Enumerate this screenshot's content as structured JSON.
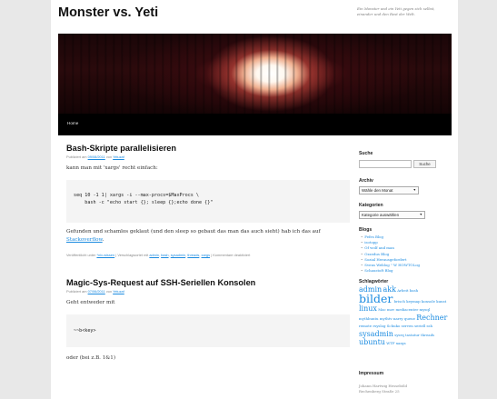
{
  "site": {
    "title": "Monster vs. Yeti",
    "description": "Ein Monster und ein Yeti gegen sich selbst, einander und den Rest der Welt."
  },
  "nav": {
    "home": "Home"
  },
  "posts": [
    {
      "title": "Bash-Skripte parallelisieren",
      "meta_prefix": "Publiziert am ",
      "date": "09/08/2011",
      "meta_by": " von ",
      "author": "Yeluzaf",
      "intro": "kann man mit 'xargs' recht einfach:",
      "code": "seq 10 -1 1| xargs -i --max-procs=$MaxProcs \\\n    bash -c \"echo start {}; sleep {};echo done {}\"",
      "outro": "Gefunden und schamlos geklaut (und den sleep so gebaut das man das auch sieht) hab ich das auf ",
      "outro_link": "Stackoverflow",
      "outro_end": ".",
      "footer": {
        "prefix": "Veröffentlicht unter ",
        "category": "*nix-wissen",
        "tags_prefix": " | Verschlagwortet mit ",
        "tags": [
          "admin",
          "bash",
          "sysadmin",
          "threads",
          "xargs"
        ],
        "comments": "Kommentare deaktiviert"
      }
    },
    {
      "title": "Magic-Sys-Request auf SSH-Seriellen Konsolen",
      "meta_prefix": "Publiziert am ",
      "date": "07/06/2011",
      "meta_by": " von ",
      "author": "Yeluzaf",
      "intro": "Geht entweder mit",
      "code": "~~b<key>",
      "outro": "oder (bei z.B. 1&1)"
    }
  ],
  "sidebar": {
    "search": {
      "title": "Suche",
      "button": "Suche",
      "value": ""
    },
    "archive": {
      "title": "Archiv",
      "selected": "Wähle den Monat"
    },
    "categories": {
      "title": "Kategorien",
      "selected": "Kategorie auswählen"
    },
    "blogs": {
      "title": "Blogs",
      "items": [
        "Fefes Blog",
        "isotopp",
        "Of wolf and man",
        "Ozzedus Blog",
        "Sozial Herausgefordert",
        "Svens Weblog \" W HOWTOLog",
        "Schaustoft Blog"
      ]
    },
    "tags": {
      "title": "Schlagwörter",
      "items": [
        {
          "label": "admin",
          "size": "large"
        },
        {
          "label": "akk",
          "size": "large"
        },
        {
          "label": "Arbeit",
          "size": "small"
        },
        {
          "label": "bash",
          "size": "small"
        },
        {
          "label": "bilder",
          "size": "huge"
        },
        {
          "label": "brisch",
          "size": "small"
        },
        {
          "label": "keymap",
          "size": "small"
        },
        {
          "label": "konsole",
          "size": "small"
        },
        {
          "label": "kunst",
          "size": "small"
        },
        {
          "label": "linux",
          "size": "large"
        },
        {
          "label": "Mac",
          "size": "small"
        },
        {
          "label": "mov",
          "size": "small"
        },
        {
          "label": "mediacenter",
          "size": "small"
        },
        {
          "label": "mysql",
          "size": "small"
        },
        {
          "label": "mythbuntu",
          "size": "small"
        },
        {
          "label": "mythtv",
          "size": "small"
        },
        {
          "label": "narry",
          "size": "small"
        },
        {
          "label": "queue",
          "size": "small"
        },
        {
          "label": "Rechner",
          "size": "large"
        },
        {
          "label": "remote",
          "size": "small"
        },
        {
          "label": "rsyslog",
          "size": "small"
        },
        {
          "label": "Schuko",
          "size": "small"
        },
        {
          "label": "serven",
          "size": "small"
        },
        {
          "label": "seriell",
          "size": "small"
        },
        {
          "label": "ssh",
          "size": "small"
        },
        {
          "label": "sysadmin",
          "size": "large"
        },
        {
          "label": "sysrq",
          "size": "small"
        },
        {
          "label": "tastatur",
          "size": "small"
        },
        {
          "label": "threads",
          "size": "small"
        },
        {
          "label": "ubuntu",
          "size": "large"
        },
        {
          "label": "WTF",
          "size": "small"
        },
        {
          "label": "xargs",
          "size": "small"
        }
      ]
    },
    "impressum": {
      "title": "Impressum",
      "lines": [
        "Johann Hartwig Hesseböld",
        "Rechenberg Straße 25"
      ]
    }
  },
  "colors": {
    "link": "#1b8be0",
    "nav_bg": "#000000",
    "code_bg": "#f4f4f4"
  }
}
